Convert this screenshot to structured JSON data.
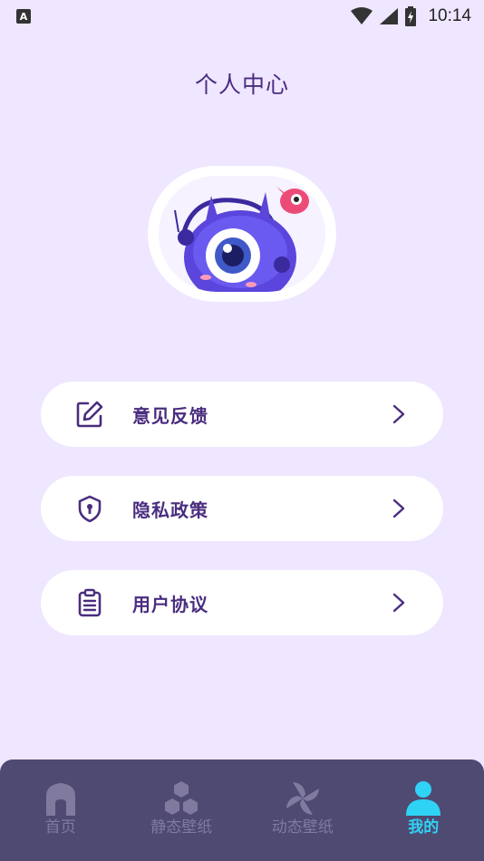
{
  "status_bar": {
    "left_icon": "A",
    "time": "10:14",
    "icons": [
      "wifi-icon",
      "signal-icon",
      "battery-icon"
    ]
  },
  "header": {
    "title": "个人中心"
  },
  "avatar": {
    "icon": "cyclops-monster-avatar"
  },
  "menu": {
    "items": [
      {
        "label": "意见反馈",
        "icon": "edit-icon"
      },
      {
        "label": "隐私政策",
        "icon": "shield-lock-icon"
      },
      {
        "label": "用户协议",
        "icon": "clipboard-icon"
      }
    ]
  },
  "tabs": [
    {
      "label": "首页",
      "icon": "home-icon",
      "active": false
    },
    {
      "label": "静态壁纸",
      "icon": "hexagons-icon",
      "active": false
    },
    {
      "label": "动态壁纸",
      "icon": "pinwheel-icon",
      "active": false
    },
    {
      "label": "我的",
      "icon": "user-icon",
      "active": true
    }
  ],
  "colors": {
    "background": "#efe6ff",
    "primary_text": "#4a2d7f",
    "card": "#ffffff",
    "tab_bar": "#4f4a72",
    "tab_inactive": "#7f7a9e",
    "tab_active": "#2fd3f6"
  }
}
